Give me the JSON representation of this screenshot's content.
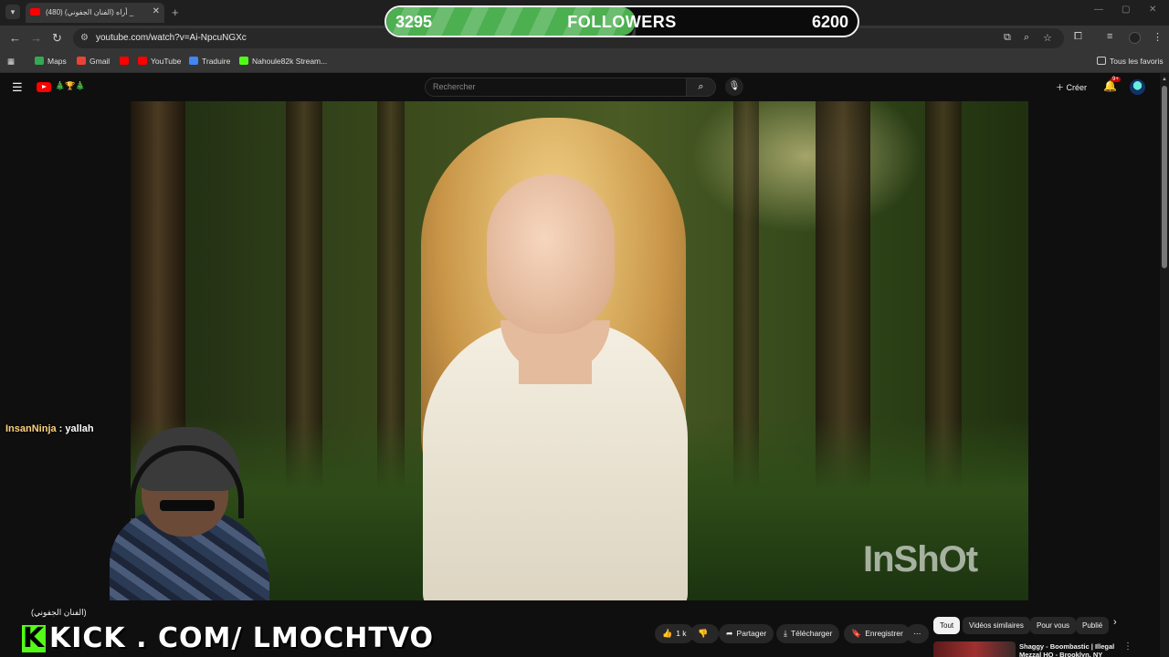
{
  "browser": {
    "tab": {
      "title": "(480) أراه (الفنان الجفوني) _",
      "close": "✕"
    },
    "new_tab": "+",
    "window_controls": {
      "minimize": "—",
      "maximize": "▢",
      "close": "✕"
    },
    "url": "youtube.com/watch?v=Ai-NpcuNGXc",
    "bookmarks": [
      {
        "label": "Maps",
        "color": "#34a853"
      },
      {
        "label": "Gmail",
        "color": "#ea4335"
      },
      {
        "label": "",
        "color": "#ff0000"
      },
      {
        "label": "YouTube",
        "color": "#ff0000"
      },
      {
        "label": "Traduire",
        "color": "#4285f4"
      },
      {
        "label": "Nahoule82k Stream...",
        "color": "#53fc18"
      }
    ],
    "all_bookmarks": "Tous les favoris"
  },
  "followers": {
    "current": "3295",
    "label": "FOLLOWERS",
    "goal": "6200",
    "progress": 0.53,
    "fill_color": "#4caf50"
  },
  "youtube": {
    "search_placeholder": "Rechercher",
    "create_label": "Créer",
    "notification_count": "9+",
    "logo_badge": "🎄🏆🎄"
  },
  "video": {
    "watermark": "InShOt"
  },
  "chat": {
    "user": "InsanNinja",
    "message": " : yallah"
  },
  "stream": {
    "kick_brand": "K",
    "kick_text": "KICK . COM/ LMOCHTVO"
  },
  "video_meta": {
    "title": "(الفنان الجفوني)",
    "actions": {
      "likes": "1 k",
      "share": "Partager",
      "download": "Télécharger",
      "save": "Enregistrer",
      "more": "⋯"
    }
  },
  "sidebar": {
    "chips": [
      "Tout",
      "Vidéos similaires",
      "Pour vous",
      "Publié"
    ],
    "recommendation": {
      "title": "Shaggy - Boombastic | Illegal Mezzal HQ - Brooklyn, NY"
    }
  },
  "colors": {
    "youtube_red": "#ff0000",
    "kick_green": "#53fc18",
    "background": "#0f0f0f"
  }
}
